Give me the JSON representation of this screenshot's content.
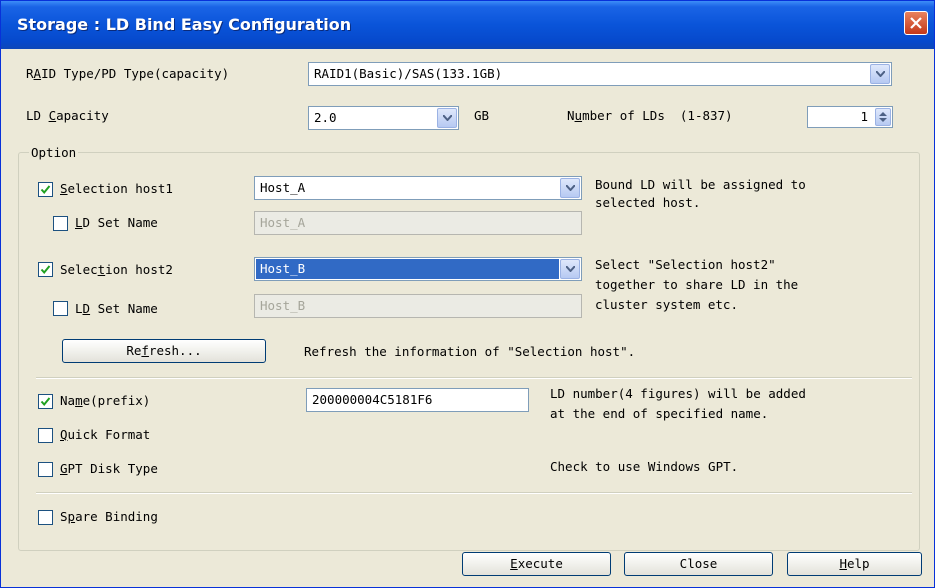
{
  "window": {
    "title": "Storage : LD Bind Easy Configuration"
  },
  "raid": {
    "label_pre": "R",
    "label_u": "A",
    "label_post": "ID Type/PD Type(capacity)",
    "value": "RAID1(Basic)/SAS(133.1GB)"
  },
  "ld_capacity": {
    "label_pre": "LD ",
    "label_u": "C",
    "label_post": "apacity",
    "value": "2.0",
    "unit": "GB"
  },
  "num_lds": {
    "label_pre": "N",
    "label_u": "u",
    "label_post": "mber of LDs  (1-837)",
    "value": "1"
  },
  "option": {
    "label": "Option"
  },
  "host1": {
    "checked": true,
    "label_pre": "",
    "label_u": "S",
    "label_post": "election host1",
    "value": "Host_A",
    "setname_label_pre": "",
    "setname_label_u": "L",
    "setname_label_post": "D Set Name",
    "setname_value": "Host_A",
    "desc1": "Bound LD will be assigned to",
    "desc2": "selected host."
  },
  "host2": {
    "checked": true,
    "label_pre": "Selec",
    "label_u": "t",
    "label_post": "ion host2",
    "value": "Host_B",
    "setname_label_pre": "L",
    "setname_label_u": "D",
    "setname_label_post": " Set Name",
    "setname_value": "Host_B",
    "desc1": "Select \"Selection host2\"",
    "desc2": "together to share LD in the",
    "desc3": "cluster system etc."
  },
  "refresh": {
    "label_pre": "Re",
    "label_u": "f",
    "label_post": "resh...",
    "desc": "Refresh the information of \"Selection host\"."
  },
  "name_prefix": {
    "checked": true,
    "label_pre": "Na",
    "label_u": "m",
    "label_post": "e(prefix)",
    "value": "200000004C5181F6",
    "desc1": "LD number(4 figures) will be added",
    "desc2": "at the end of specified name."
  },
  "quick_format": {
    "checked": false,
    "label_pre": "",
    "label_u": "Q",
    "label_post": "uick Format"
  },
  "gpt": {
    "checked": false,
    "label_pre": "",
    "label_u": "G",
    "label_post": "PT Disk Type",
    "desc": "Check to use Windows GPT."
  },
  "spare": {
    "checked": false,
    "label_pre": "S",
    "label_u": "p",
    "label_post": "are Binding"
  },
  "buttons": {
    "execute_pre": "",
    "execute_u": "E",
    "execute_post": "xecute",
    "close": "Close",
    "help_pre": "",
    "help_u": "H",
    "help_post": "elp"
  }
}
